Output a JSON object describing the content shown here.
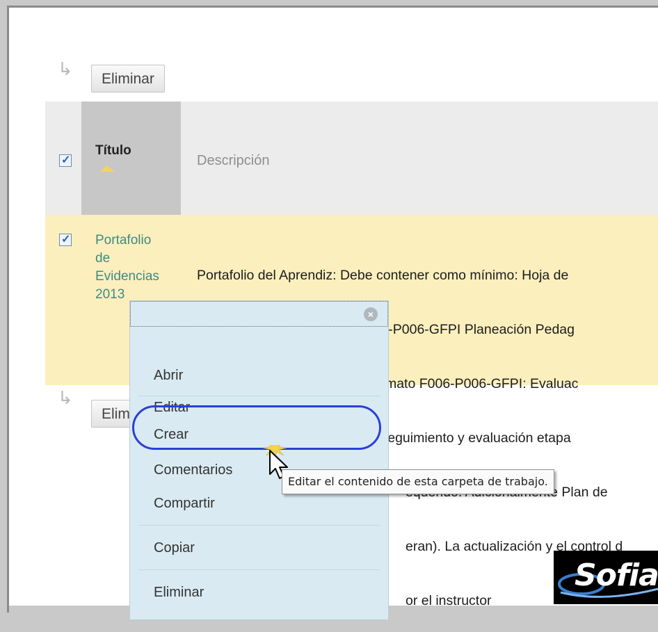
{
  "toolbar": {
    "delete_top_label": "Eliminar",
    "delete_bottom_label": "Elimin"
  },
  "table": {
    "header": {
      "title_col": "Título",
      "description_col": "Descripción"
    },
    "rows": [
      {
        "title_lines": [
          "Portafolio",
          "de",
          "Evidencias",
          "2013"
        ],
        "description_lines": [
          "Portafolio del Aprendiz: Debe contener como mínimo: Hoja de",
          "GFPI Proyecto Formativo, F003-P006-GFPI Planeación Pedag",
          "GFPI Guías de Aprendizaje, formato F006-P006-GFPI: Evaluac",
          "F008-P006-GFPI Planeación, Seguimiento y evaluación etapa",
          "equerido. Adicionalmente Plan de",
          "eran). La actualización y el control d",
          "or el instructor"
        ]
      }
    ]
  },
  "context_menu": {
    "items": [
      "Abrir",
      "Editar",
      "Crear",
      "Comentarios",
      "Compartir",
      "Copiar",
      "Eliminar"
    ]
  },
  "tooltip": {
    "text": "Editar el contenido de esta carpeta de trabajo."
  },
  "logo": {
    "text": "Sofia"
  },
  "colors": {
    "menu_bg": "#d9eaf2",
    "row_highlight": "#fbefbd",
    "focus_ring": "#2a3fd6",
    "link_teal": "#3e8a86"
  }
}
